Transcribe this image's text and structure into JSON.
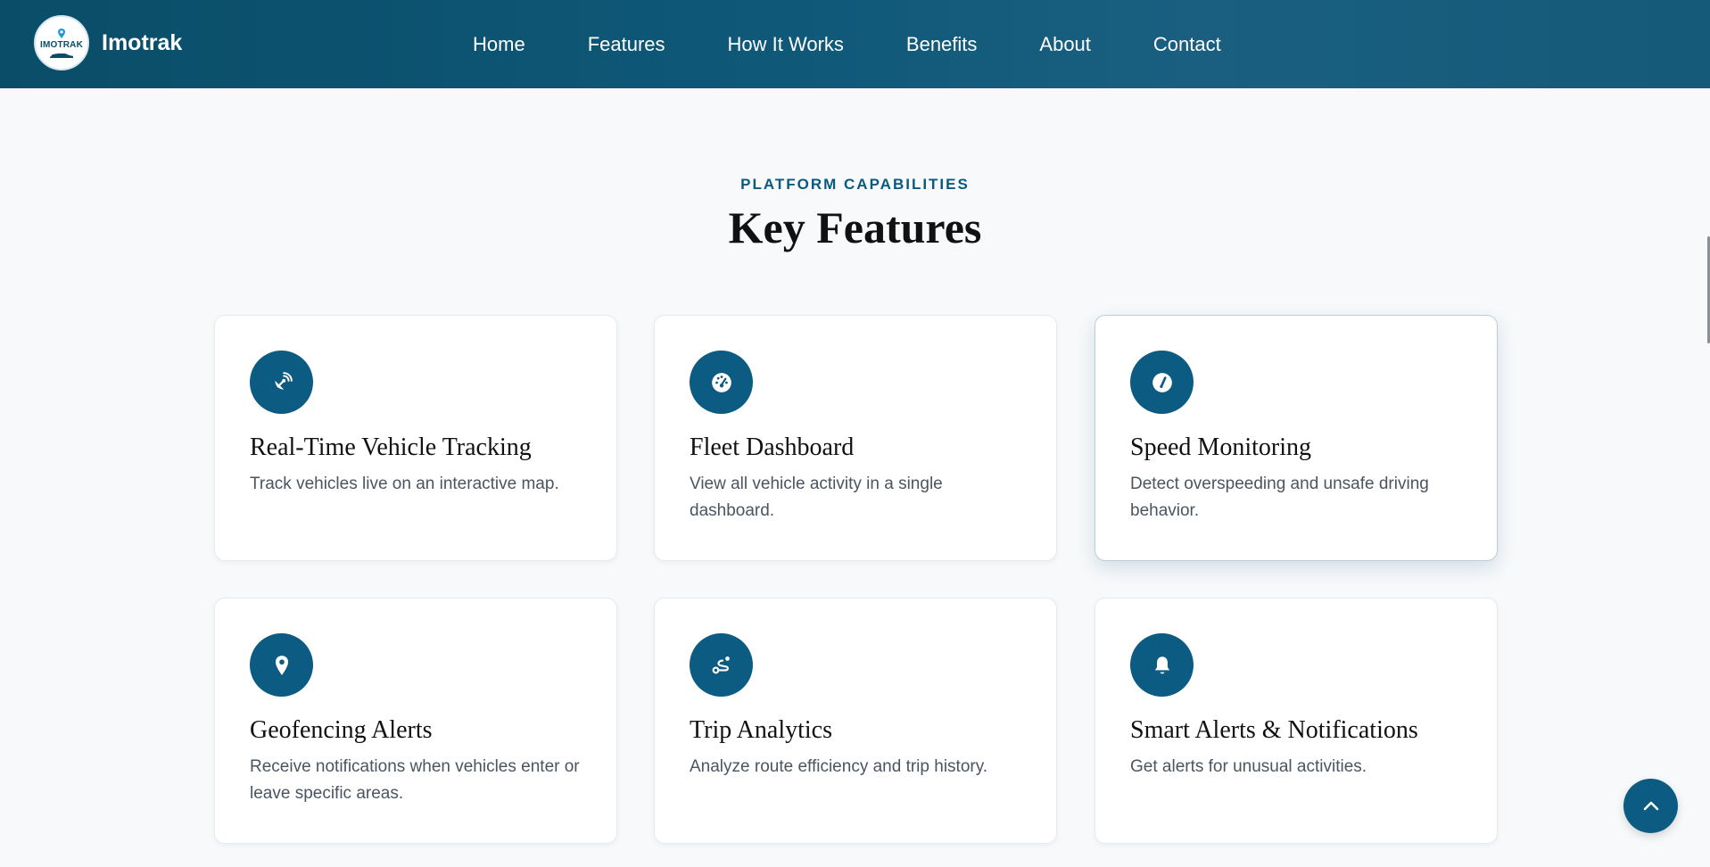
{
  "brand": {
    "logo_text": "IMOTRAK",
    "name": "Imotrak"
  },
  "nav": {
    "items": [
      {
        "label": "Home"
      },
      {
        "label": "Features"
      },
      {
        "label": "How It Works"
      },
      {
        "label": "Benefits"
      },
      {
        "label": "About"
      },
      {
        "label": "Contact"
      }
    ]
  },
  "section": {
    "eyebrow": "PLATFORM CAPABILITIES",
    "title": "Key Features"
  },
  "features": [
    {
      "icon": "satellite-dish-icon",
      "title": "Real-Time Vehicle Tracking",
      "description": "Track vehicles live on an interactive map."
    },
    {
      "icon": "gauge-dashboard-icon",
      "title": "Fleet Dashboard",
      "description": "View all vehicle activity in a single dashboard."
    },
    {
      "icon": "speedometer-icon",
      "title": "Speed Monitoring",
      "description": "Detect overspeeding and unsafe driving behavior."
    },
    {
      "icon": "map-pin-icon",
      "title": "Geofencing Alerts",
      "description": "Receive notifications when vehicles enter or leave specific areas."
    },
    {
      "icon": "route-icon",
      "title": "Trip Analytics",
      "description": "Analyze route efficiency and trip history."
    },
    {
      "icon": "bell-icon",
      "title": "Smart Alerts & Notifications",
      "description": "Get alerts for unusual activities."
    }
  ],
  "colors": {
    "primary": "#0b5b82",
    "nav_bg": "#0f5878",
    "page_bg": "#f7f9fb"
  },
  "back_to_top": {
    "icon": "chevron-up-icon"
  }
}
